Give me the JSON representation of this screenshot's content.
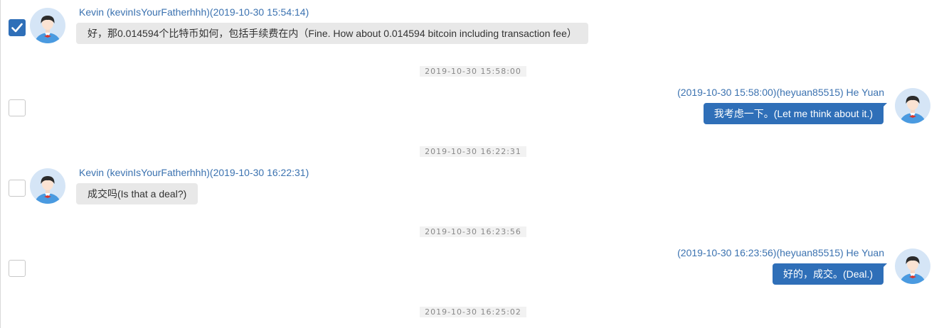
{
  "messages": [
    {
      "direction": "in",
      "selected": true,
      "meta": "Kevin (kevinIsYourFatherhhh)(2019-10-30 15:54:14)",
      "text": "好，那0.014594个比特币如何，包括手续费在内（Fine. How about 0.014594 bitcoin including transaction fee）"
    },
    {
      "direction": "out",
      "selected": false,
      "meta": "(2019-10-30 15:58:00)(heyuan85515) He Yuan",
      "text": "我考虑一下。(Let me think about it.)"
    },
    {
      "direction": "in",
      "selected": false,
      "meta": "Kevin (kevinIsYourFatherhhh)(2019-10-30 16:22:31)",
      "text": "成交吗(Is that a deal?)"
    },
    {
      "direction": "out",
      "selected": false,
      "meta": "(2019-10-30 16:23:56)(heyuan85515) He Yuan",
      "text": "好的，成交。(Deal.)"
    }
  ],
  "timestamps": [
    "2019-10-30 15:58:00",
    "2019-10-30 16:22:31",
    "2019-10-30 16:23:56",
    "2019-10-30 16:25:02"
  ],
  "colors": {
    "accent": "#2f6fb8",
    "meta_text": "#3b72b0",
    "incoming_bubble": "#e8e8e8",
    "avatar_bg": "#d5e5f6"
  },
  "icons": {
    "checkbox_checked": "checkmark-icon",
    "avatar": "user-avatar-icon"
  }
}
